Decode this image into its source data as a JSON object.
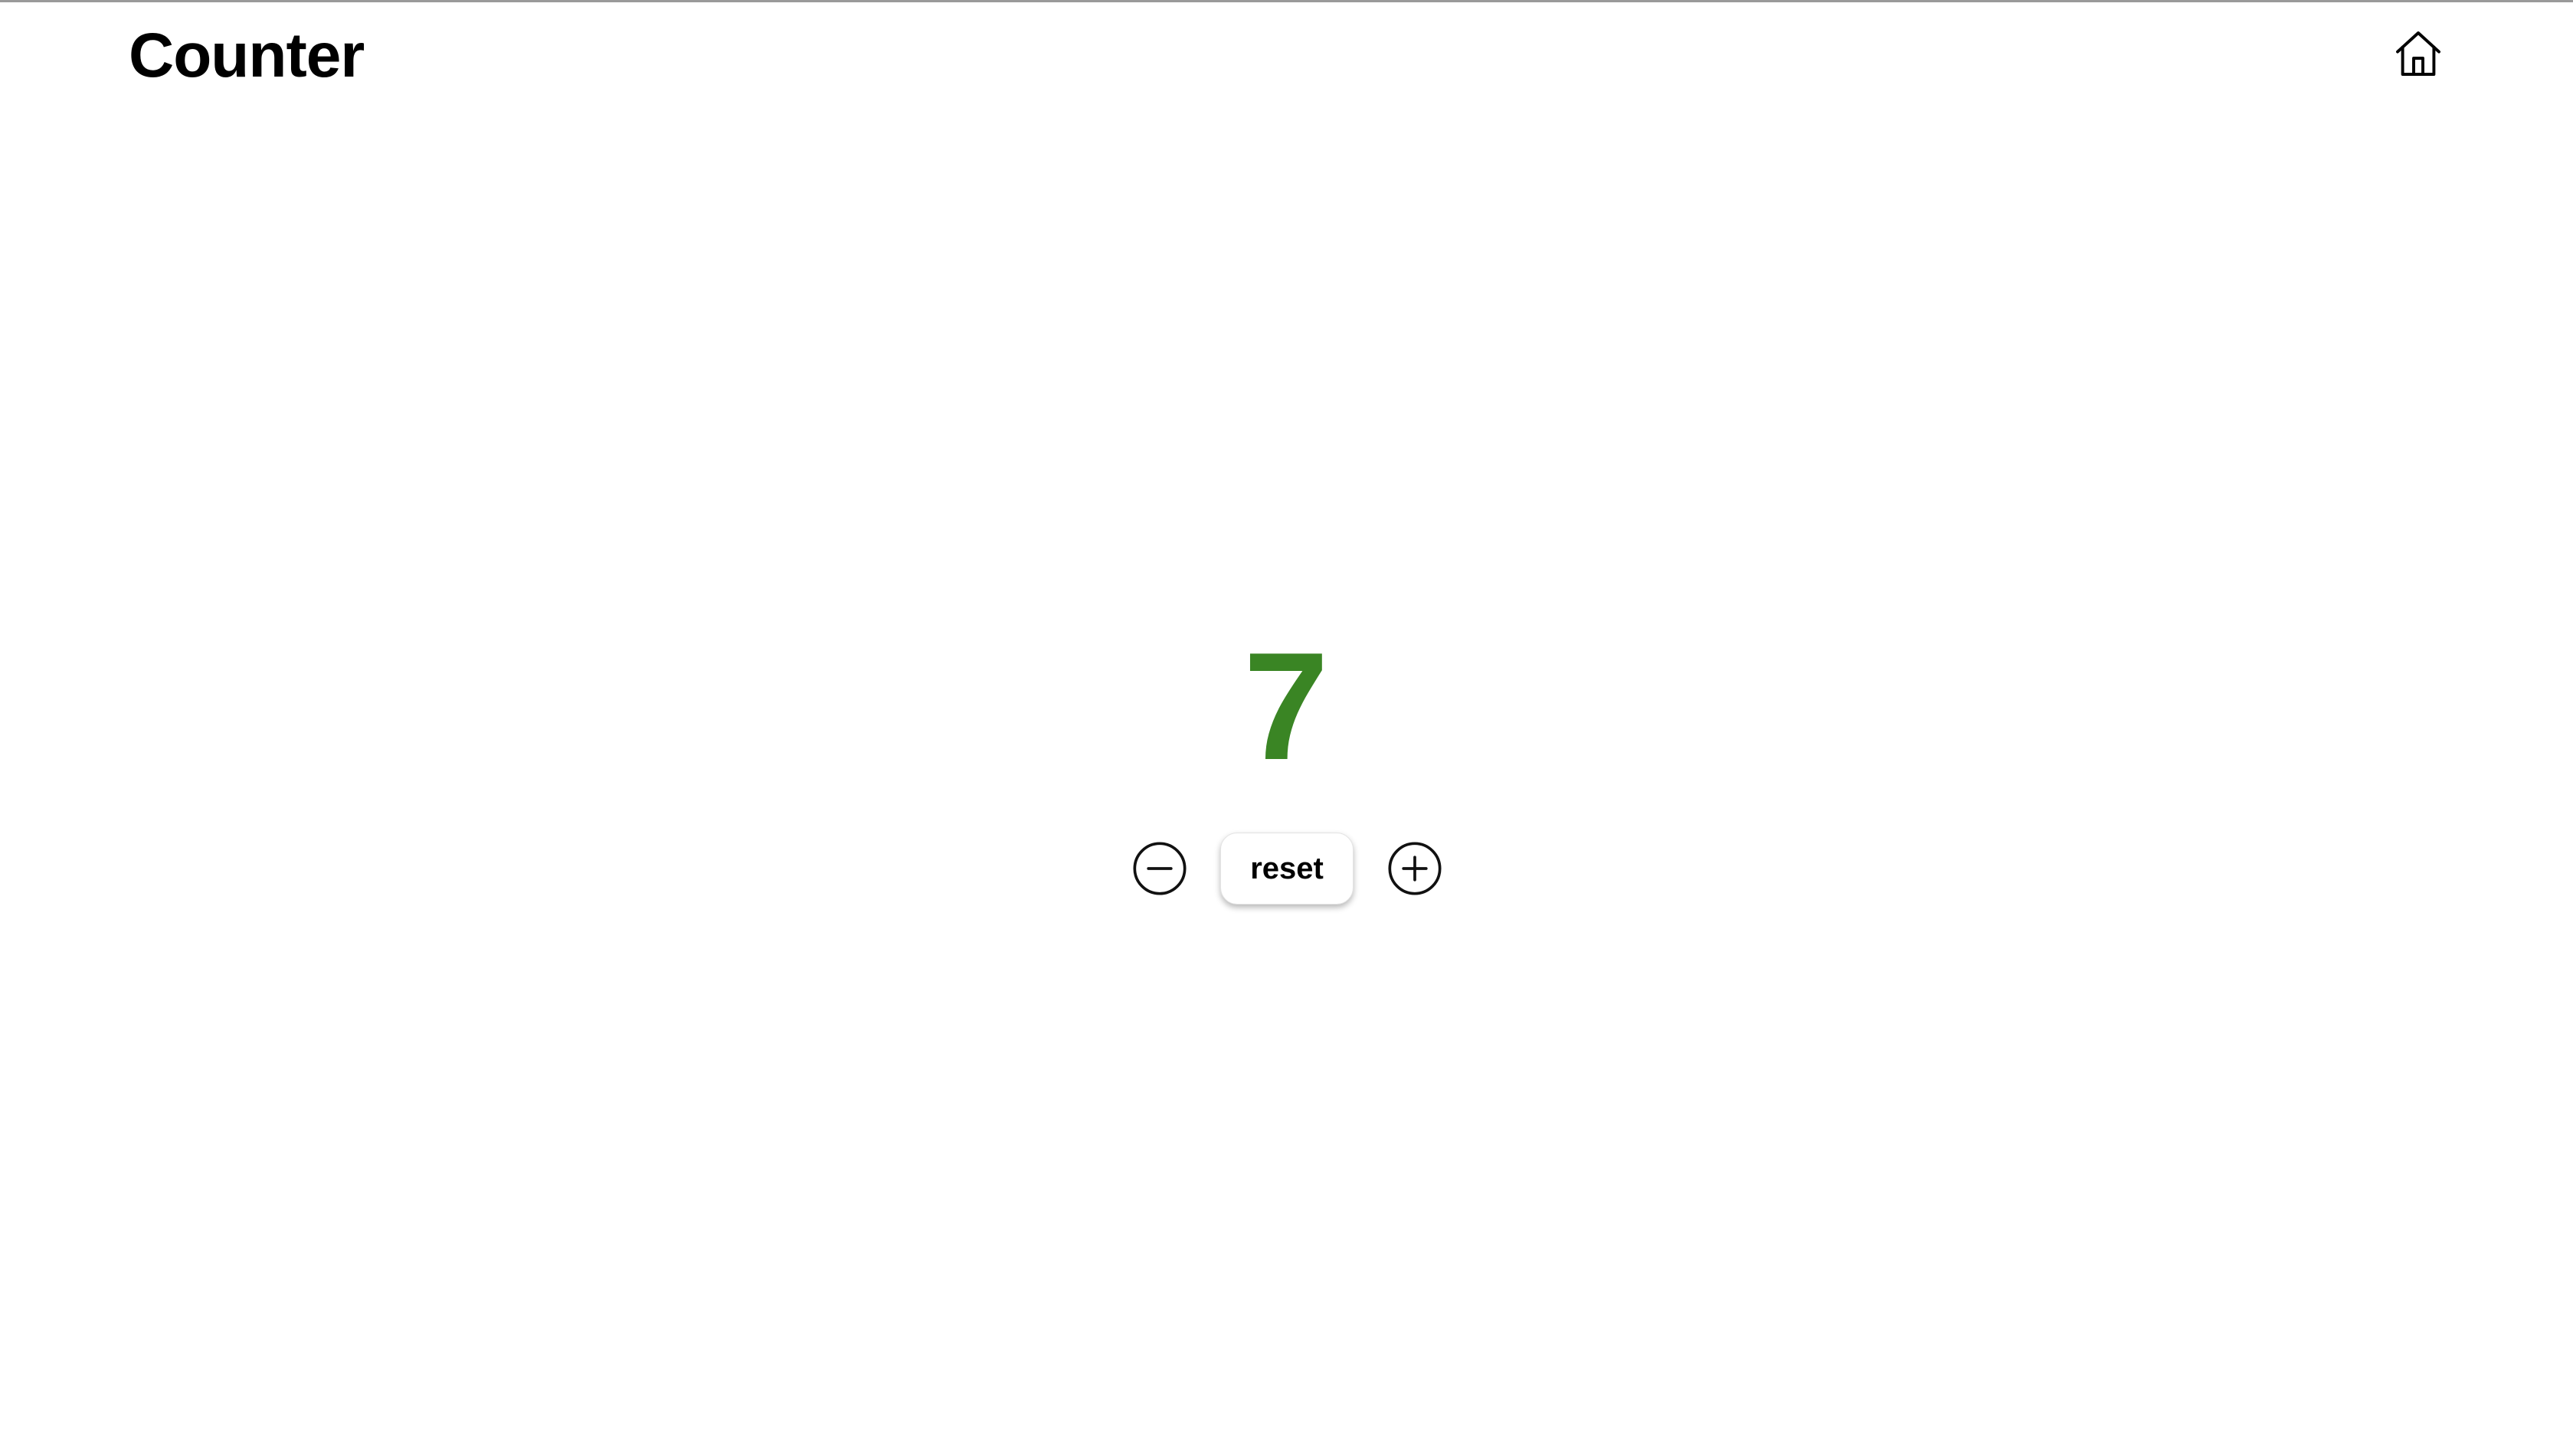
{
  "header": {
    "title": "Counter",
    "home_icon": "home-icon"
  },
  "counter": {
    "value": "7",
    "value_color": "#3a8524"
  },
  "controls": {
    "decrement_icon": "minus-circle-icon",
    "reset_label": "reset",
    "increment_icon": "plus-circle-icon"
  }
}
